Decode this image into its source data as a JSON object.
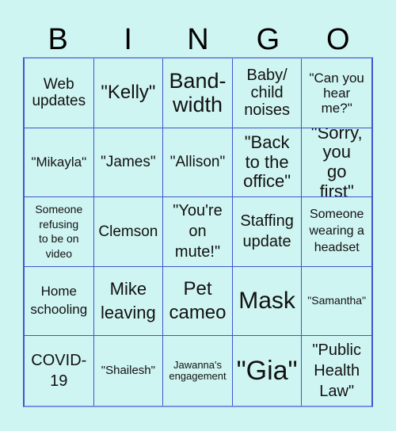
{
  "header": [
    "B",
    "I",
    "N",
    "G",
    "O"
  ],
  "cells": [
    "Web updates",
    "\"Kelly\"",
    "Band-width",
    "Baby/ child noises",
    "\"Can you hear me?\"",
    "\"Mikayla\"",
    "\"James\"",
    "\"Allison\"",
    "\"Back to the office\"",
    "\"Sorry, you go first\"",
    "Someone refusing to be on video",
    "Clemson",
    "\"You're on mute!\"",
    "Staffing update",
    "Someone wearing a headset",
    "Home schooling",
    "Mike leaving",
    "Pet cameo",
    "Mask",
    "\"Samantha\"",
    "COVID-19",
    "\"Shailesh\"",
    "Jawanna's engagement",
    "\"Gia\"",
    "\"Public Health Law\""
  ],
  "colors": {
    "background": "#cff5f2",
    "border": "#3e55d0"
  }
}
